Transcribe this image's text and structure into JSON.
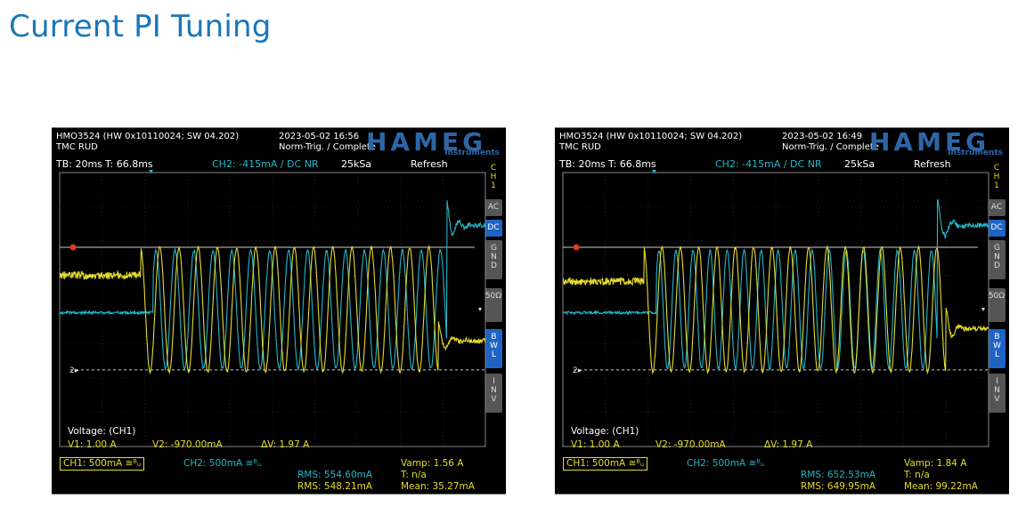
{
  "page": {
    "title": "Current PI Tuning"
  },
  "scopes": [
    {
      "header_line1": "HMO3524 (HW 0x10110024; SW 04.202)",
      "header_line2": "TMC RUD",
      "datetime": "2023-05-02 16:56",
      "trigger": "Norm-Trig. / Complete",
      "logo": "HAMEG",
      "logo_sub": "Instruments",
      "tb": "TB: 20ms",
      "t": "T: 66.8ms",
      "ch2_trigger": "CH2: -415mA ∕ DC NR",
      "sample_rate": "25kSa",
      "refresh": "Refresh",
      "ch_label": "CH1",
      "side_buttons": {
        "ac": "AC",
        "dc": "DC",
        "gnd": "GND",
        "ohm": "50Ω",
        "bwl": "BWL",
        "inv": "INV"
      },
      "cursor_title": "Voltage: (CH1)",
      "v1": "V1: 1.00 A",
      "v2": "V2: -970.00mA",
      "dv": "ΔV: 1.97 A",
      "ch1_scale": "CH1: 500mA ≅ᴮᵤ",
      "ch2_scale": "CH2: 500mA ≅ᴮᵤ",
      "rms1": "RMS: 554.60mA",
      "rms2": "RMS: 548.21mA",
      "vamp": "Vamp: 1.56 A",
      "tper": "T: n/a",
      "mean": "Mean: 35.27mA"
    },
    {
      "header_line1": "HMO3524 (HW 0x10110024; SW 04.202)",
      "header_line2": "TMC RUD",
      "datetime": "2023-05-02 16:49",
      "trigger": "Norm-Trig. / Complete",
      "logo": "HAMEG",
      "logo_sub": "Instruments",
      "tb": "TB: 20ms",
      "t": "T: 66.8ms",
      "ch2_trigger": "CH2: -415mA ∕ DC NR",
      "sample_rate": "25kSa",
      "refresh": "Refresh",
      "ch_label": "CH1",
      "side_buttons": {
        "ac": "AC",
        "dc": "DC",
        "gnd": "GND",
        "ohm": "50Ω",
        "bwl": "BWL",
        "inv": "INV"
      },
      "cursor_title": "Voltage: (CH1)",
      "v1": "V1: 1.00 A",
      "v2": "V2: -970.00mA",
      "dv": "ΔV: 1.97 A",
      "ch1_scale": "CH1: 500mA ≅ᴮᵤ",
      "ch2_scale": "CH2: 500mA ≅ᴮᵤ",
      "rms1": "RMS: 652.53mA",
      "rms2": "RMS: 649.95mA",
      "vamp": "Vamp: 1.84 A",
      "tper": "T: n/a",
      "mean": "Mean: 99.22mA"
    }
  ],
  "chart_data": [
    {
      "type": "line",
      "xlabel": "",
      "ylabel": "",
      "series": [
        {
          "name": "CH1",
          "color": "#e4dc2c",
          "baseline": 0.55,
          "step_at": 0.19,
          "cycles": 15.5,
          "amplitude": 1.0,
          "end_at": 0.89,
          "settle": -0.5
        },
        {
          "name": "CH2",
          "color": "#23b6c8",
          "baseline": -0.05,
          "step_at": 0.22,
          "cycles": 15.5,
          "amplitude": 0.95,
          "end_at": 0.91,
          "settle": 1.35
        }
      ]
    },
    {
      "type": "line",
      "xlabel": "",
      "ylabel": "",
      "series": [
        {
          "name": "CH1",
          "color": "#e4dc2c",
          "baseline": 0.45,
          "step_at": 0.19,
          "cycles": 16.5,
          "amplitude": 1.0,
          "end_at": 0.9,
          "settle": -0.3
        },
        {
          "name": "CH2",
          "color": "#23b6c8",
          "baseline": -0.05,
          "step_at": 0.22,
          "cycles": 16.5,
          "amplitude": 0.95,
          "end_at": 0.88,
          "settle": 1.35
        }
      ]
    }
  ]
}
